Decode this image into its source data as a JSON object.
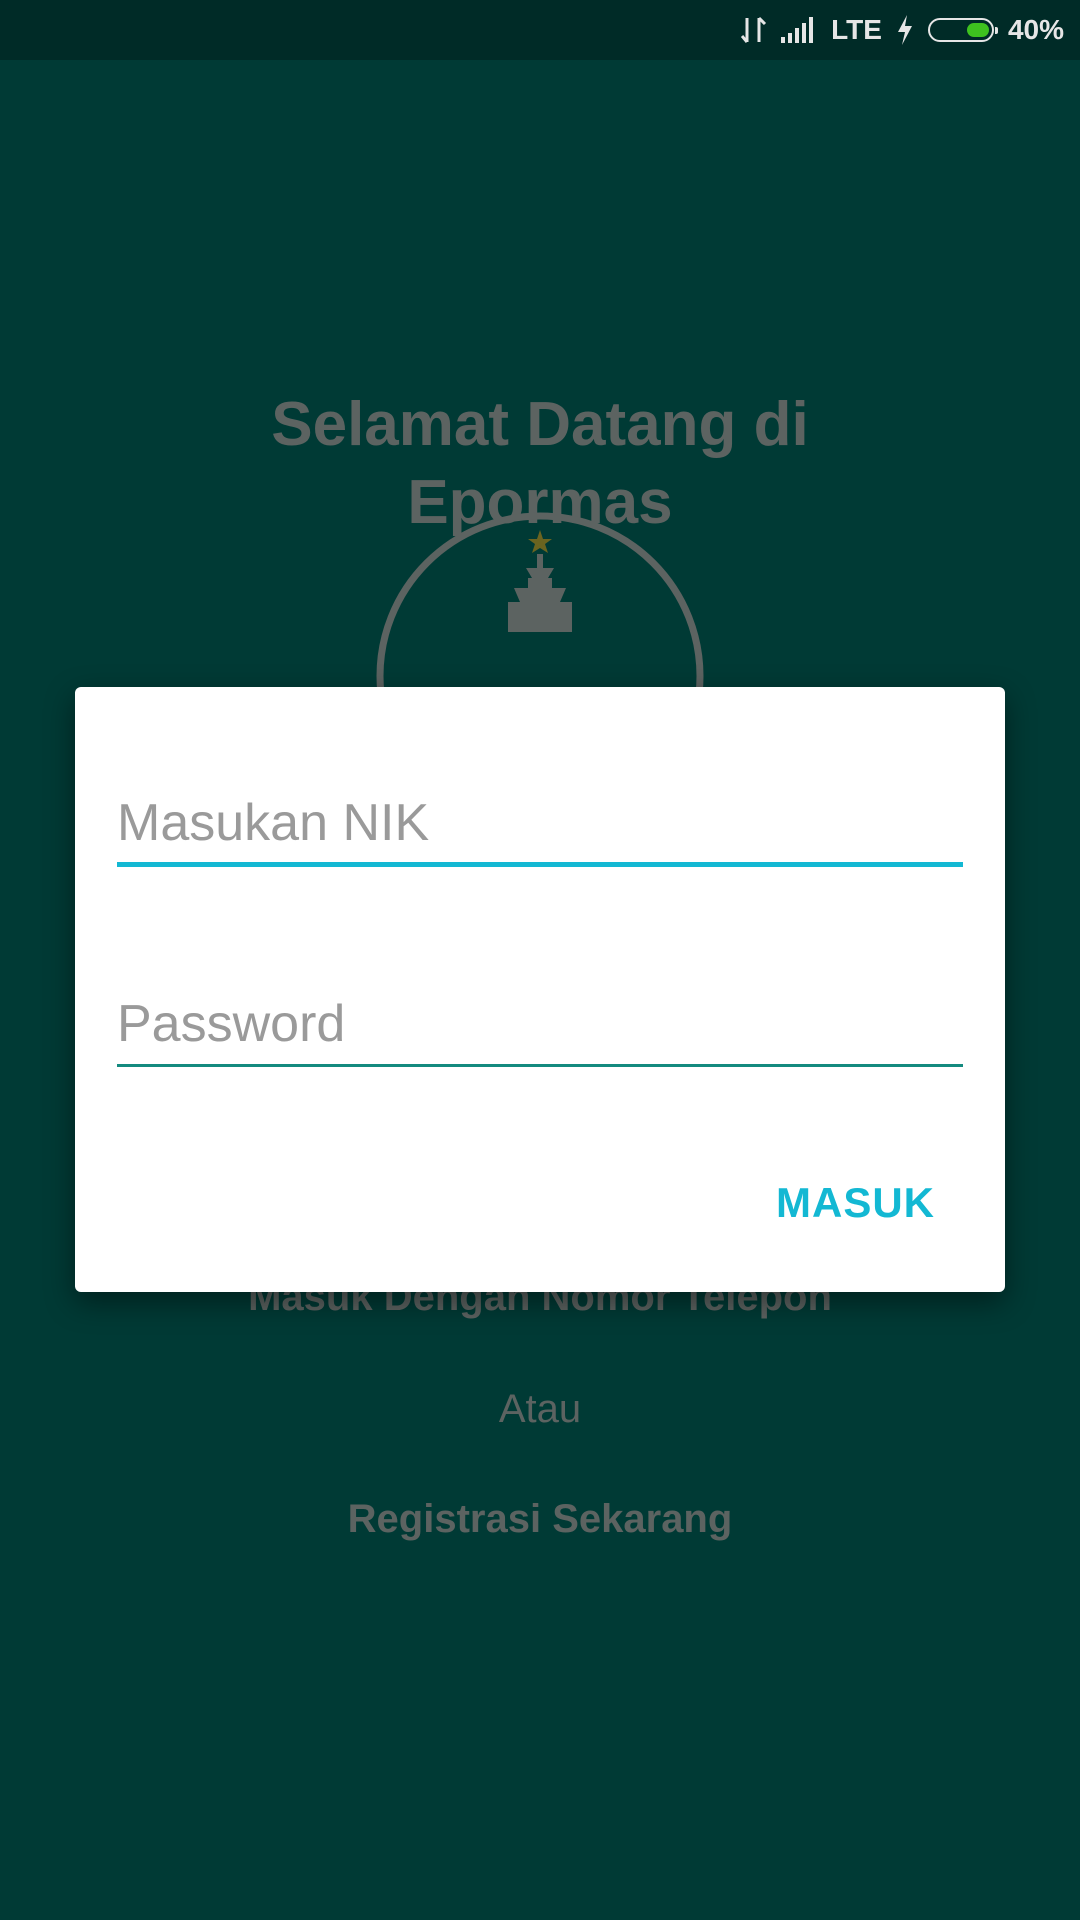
{
  "status_bar": {
    "network": "LTE",
    "battery_percent": "40%",
    "battery_level": 0.4,
    "icons": [
      "data-activity-icon",
      "signal-icon",
      "charging-icon",
      "battery-icon"
    ]
  },
  "background": {
    "title_line1": "Selamat Datang di",
    "title_line2": "Epormas",
    "phone_login_link": "Masuk Dengan Nomor Telepon",
    "or_text": "Atau",
    "register_link": "Registrasi Sekarang"
  },
  "dialog": {
    "nik_placeholder": "Masukan NIK",
    "nik_value": "",
    "password_placeholder": "Password",
    "password_value": "",
    "submit_label": "MASUK"
  },
  "colors": {
    "background": "#003a35",
    "status_bar": "#002b27",
    "accent": "#13b8d3",
    "field_line": "#148a7f",
    "battery": "#3ec21f"
  }
}
